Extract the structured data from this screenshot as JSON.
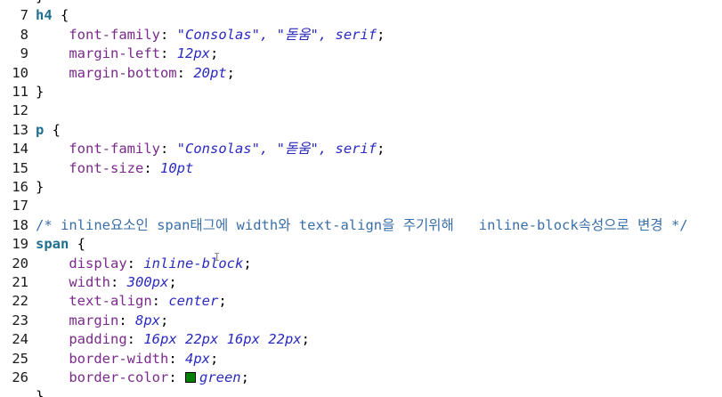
{
  "editor": {
    "lines": [
      {
        "num": "",
        "tokens": [
          {
            "t": "}",
            "c": "brace"
          }
        ]
      },
      {
        "num": "7",
        "tokens": [
          {
            "t": "h4",
            "c": "sel"
          },
          {
            "t": " {",
            "c": "brace"
          }
        ]
      },
      {
        "num": "8",
        "tokens": [
          {
            "t": "    font-family",
            "c": "prop"
          },
          {
            "t": ": ",
            "c": "punct"
          },
          {
            "t": "\"Consolas\", \"돋움\", serif",
            "c": "val"
          },
          {
            "t": ";",
            "c": "punct"
          }
        ]
      },
      {
        "num": "9",
        "tokens": [
          {
            "t": "    margin-left",
            "c": "prop"
          },
          {
            "t": ": ",
            "c": "punct"
          },
          {
            "t": "12px",
            "c": "val"
          },
          {
            "t": ";",
            "c": "punct"
          }
        ]
      },
      {
        "num": "10",
        "tokens": [
          {
            "t": "    margin-bottom",
            "c": "prop"
          },
          {
            "t": ": ",
            "c": "punct"
          },
          {
            "t": "20pt",
            "c": "val"
          },
          {
            "t": ";",
            "c": "punct"
          }
        ]
      },
      {
        "num": "11",
        "tokens": [
          {
            "t": "}",
            "c": "brace"
          }
        ]
      },
      {
        "num": "12",
        "tokens": []
      },
      {
        "num": "13",
        "tokens": [
          {
            "t": "p",
            "c": "sel"
          },
          {
            "t": " {",
            "c": "brace"
          }
        ]
      },
      {
        "num": "14",
        "tokens": [
          {
            "t": "    font-family",
            "c": "prop"
          },
          {
            "t": ": ",
            "c": "punct"
          },
          {
            "t": "\"Consolas\", \"돋움\", serif",
            "c": "val"
          },
          {
            "t": ";",
            "c": "punct"
          }
        ]
      },
      {
        "num": "15",
        "tokens": [
          {
            "t": "    font-size",
            "c": "prop"
          },
          {
            "t": ": ",
            "c": "punct"
          },
          {
            "t": "10pt",
            "c": "val"
          }
        ]
      },
      {
        "num": "16",
        "tokens": [
          {
            "t": "}",
            "c": "brace"
          }
        ]
      },
      {
        "num": "17",
        "tokens": []
      },
      {
        "num": "18",
        "tokens": [
          {
            "t": "/* inline요소인 span태그에 width와 text-align을 주기위해   inline-block속성으로 변경 */",
            "c": "comment"
          }
        ]
      },
      {
        "num": "19",
        "tokens": [
          {
            "t": "span",
            "c": "sel"
          },
          {
            "t": " {",
            "c": "brace"
          }
        ]
      },
      {
        "num": "20",
        "tokens": [
          {
            "t": "    display",
            "c": "prop"
          },
          {
            "t": ": ",
            "c": "punct"
          },
          {
            "t": "inline-block",
            "c": "val"
          },
          {
            "t": ";",
            "c": "punct"
          }
        ]
      },
      {
        "num": "21",
        "tokens": [
          {
            "t": "    width",
            "c": "prop"
          },
          {
            "t": ": ",
            "c": "punct"
          },
          {
            "t": "300px",
            "c": "val"
          },
          {
            "t": ";",
            "c": "punct"
          }
        ]
      },
      {
        "num": "22",
        "tokens": [
          {
            "t": "    text-align",
            "c": "prop"
          },
          {
            "t": ": ",
            "c": "punct"
          },
          {
            "t": "center",
            "c": "val"
          },
          {
            "t": ";",
            "c": "punct"
          }
        ]
      },
      {
        "num": "23",
        "tokens": [
          {
            "t": "    margin",
            "c": "prop"
          },
          {
            "t": ": ",
            "c": "punct"
          },
          {
            "t": "8px",
            "c": "val"
          },
          {
            "t": ";",
            "c": "punct"
          }
        ]
      },
      {
        "num": "24",
        "tokens": [
          {
            "t": "    padding",
            "c": "prop"
          },
          {
            "t": ": ",
            "c": "punct"
          },
          {
            "t": "16px 22px 16px 22px",
            "c": "val"
          },
          {
            "t": ";",
            "c": "punct"
          }
        ]
      },
      {
        "num": "25",
        "tokens": [
          {
            "t": "    border-width",
            "c": "prop"
          },
          {
            "t": ": ",
            "c": "punct"
          },
          {
            "t": "4px",
            "c": "val"
          },
          {
            "t": ";",
            "c": "punct"
          }
        ]
      },
      {
        "num": "26",
        "tokens": [
          {
            "t": "    border-color",
            "c": "prop"
          },
          {
            "t": ": ",
            "c": "punct"
          },
          {
            "t": "swatch",
            "c": "swatch"
          },
          {
            "t": "green",
            "c": "val"
          },
          {
            "t": ";",
            "c": "punct"
          }
        ]
      },
      {
        "num": "",
        "tokens": [
          {
            "t": "}",
            "c": "brace"
          }
        ]
      }
    ],
    "swatch_color": "#008000"
  }
}
